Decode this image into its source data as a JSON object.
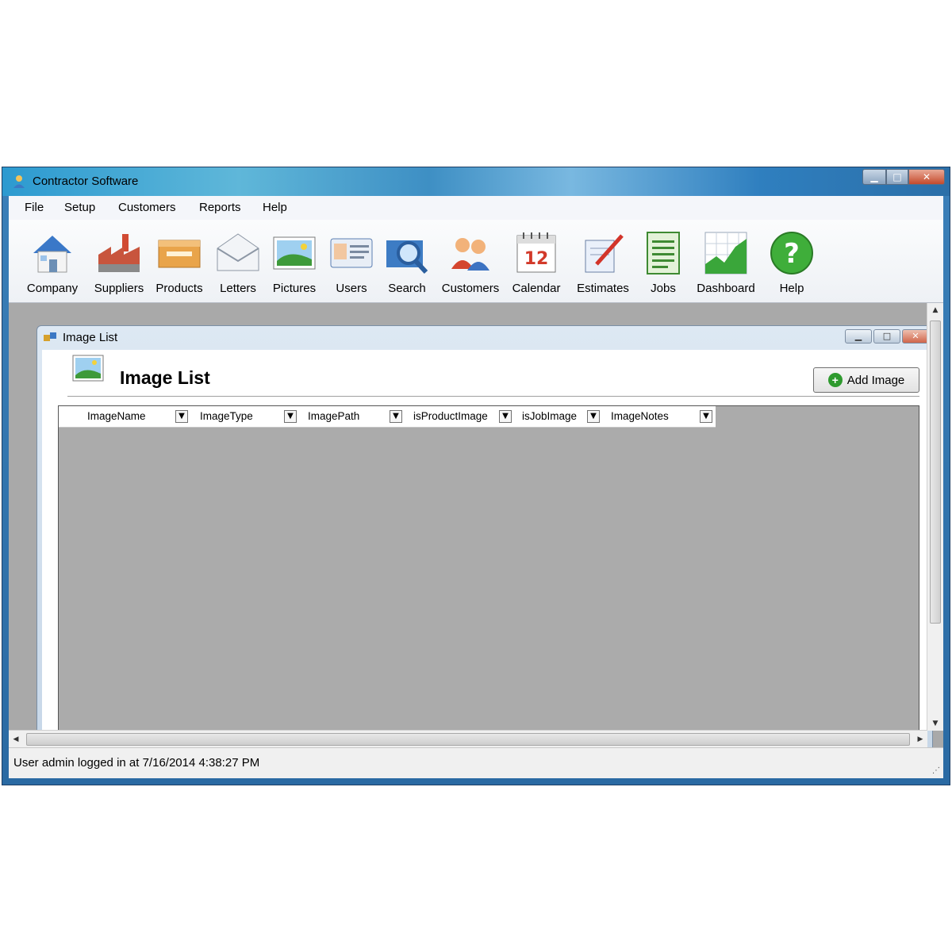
{
  "window": {
    "title": "Contractor Software"
  },
  "menu": [
    "File",
    "Setup",
    "Customers",
    "Reports",
    "Help"
  ],
  "toolbar": [
    {
      "label": "Company",
      "icon": "house-icon"
    },
    {
      "label": "Suppliers",
      "icon": "factory-icon"
    },
    {
      "label": "Products",
      "icon": "boxes-icon"
    },
    {
      "label": "Letters",
      "icon": "envelope-icon"
    },
    {
      "label": "Pictures",
      "icon": "picture-icon"
    },
    {
      "label": "Users",
      "icon": "id-card-icon"
    },
    {
      "label": "Search",
      "icon": "magnifier-icon"
    },
    {
      "label": "Customers",
      "icon": "people-icon"
    },
    {
      "label": "Calendar",
      "icon": "calendar-icon"
    },
    {
      "label": "Estimates",
      "icon": "pen-paper-icon"
    },
    {
      "label": "Jobs",
      "icon": "list-icon"
    },
    {
      "label": "Dashboard",
      "icon": "chart-icon"
    },
    {
      "label": "Help",
      "icon": "help-icon"
    }
  ],
  "calendar_day": "12",
  "child": {
    "title": "Image List",
    "form_title": "Image List",
    "add_button": "Add Image",
    "columns": [
      "ImageName",
      "ImageType",
      "ImagePath",
      "isProductImage",
      "isJobImage",
      "ImageNotes"
    ]
  },
  "status": "User admin logged in at 7/16/2014 4:38:27 PM",
  "colors": {
    "accent": "#3a7fb8",
    "mdi_background": "#a9a9a9",
    "add_icon": "#2e9a2e"
  }
}
